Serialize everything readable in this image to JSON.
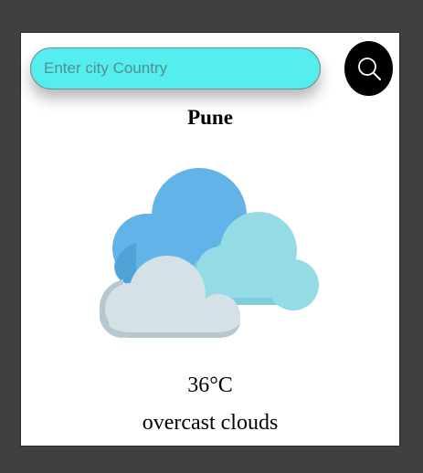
{
  "search": {
    "placeholder": "Enter city Country",
    "value": ""
  },
  "icons": {
    "search_button": "search-icon",
    "weather": "overcast-clouds-icon"
  },
  "weather": {
    "city": "Pune",
    "temperature": "36°C",
    "description": "overcast clouds"
  },
  "colors": {
    "page_background": "#404040",
    "card_background": "#ffffff",
    "search_field": "#55eeee",
    "search_button": "#000000",
    "cloud_blue": "#62b3e8",
    "cloud_teal": "#94dbe6",
    "cloud_gray": "#d4e1e6"
  }
}
